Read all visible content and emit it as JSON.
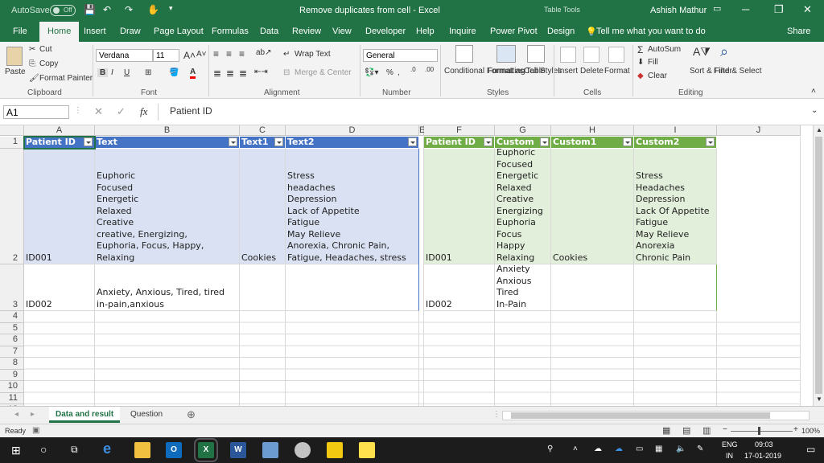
{
  "title_bar": {
    "autosave_label": "AutoSave",
    "autosave_state": "Off",
    "doc_title": "Remove duplicates from cell  -  Excel",
    "context_tab": "Table Tools",
    "user_name": "Ashish Mathur"
  },
  "menu": {
    "tabs": [
      "File",
      "Home",
      "Insert",
      "Draw",
      "Page Layout",
      "Formulas",
      "Data",
      "Review",
      "View",
      "Developer",
      "Help",
      "Inquire",
      "Power Pivot",
      "Design"
    ],
    "tell_me": "Tell me what you want to do",
    "share": "Share"
  },
  "ribbon": {
    "clipboard": {
      "paste": "Paste",
      "cut": "Cut",
      "copy": "Copy",
      "format_painter": "Format Painter",
      "group": "Clipboard"
    },
    "font": {
      "name": "Verdana",
      "size": "11",
      "group": "Font"
    },
    "alignment": {
      "wrap_text": "Wrap Text",
      "merge_center": "Merge & Center",
      "group": "Alignment"
    },
    "number": {
      "format": "General",
      "group": "Number"
    },
    "styles": {
      "conditional_formatting": "Conditional Formatting",
      "format_as_table": "Format as Table",
      "cell_styles": "Cell Styles",
      "group": "Styles"
    },
    "cells": {
      "insert": "Insert",
      "delete": "Delete",
      "format": "Format",
      "group": "Cells"
    },
    "editing": {
      "autosum": "AutoSum",
      "fill": "Fill",
      "clear": "Clear",
      "sort_filter": "Sort & Filter",
      "find_select": "Find & Select",
      "group": "Editing"
    }
  },
  "formula_bar": {
    "name_box": "A1",
    "fx": "fx",
    "content": "Patient ID"
  },
  "columns": [
    "A",
    "B",
    "C",
    "D",
    "E",
    "F",
    "G",
    "H",
    "I",
    "J"
  ],
  "rows": [
    "1",
    "2",
    "3",
    "4",
    "5",
    "6",
    "7",
    "8",
    "9",
    "10",
    "11",
    "12"
  ],
  "table1": {
    "headers": [
      "Patient ID",
      "Text",
      "Text1",
      "Text2"
    ],
    "rows": [
      [
        "ID001",
        "Euphoric\nFocused\nEnergetic\nRelaxed\nCreative\ncreative, Energizing,\nEuphoria, Focus, Happy,\nRelaxing",
        "Cookies",
        "Stress\nheadaches\nDepression\nLack of Appetite\nFatigue\nMay Relieve\nAnorexia, Chronic Pain,\nFatigue, Headaches, stress"
      ],
      [
        "ID002",
        "Anxiety, Anxious, Tired, tired\nin-pain,anxious",
        "",
        ""
      ]
    ]
  },
  "table2": {
    "headers": [
      "Patient ID",
      "Custom",
      "Custom1",
      "Custom2"
    ],
    "rows": [
      [
        "ID001",
        "Euphoric\nFocused\nEnergetic\nRelaxed\nCreative\nEnergizing\nEuphoria\nFocus\nHappy\nRelaxing",
        "Cookies",
        "Stress\nHeadaches\nDepression\nLack Of Appetite\nFatigue\nMay Relieve\nAnorexia\nChronic Pain"
      ],
      [
        "ID002",
        "Anxiety\nAnxious\nTired\nIn-Pain",
        "",
        ""
      ]
    ]
  },
  "sheets": {
    "tabs": [
      "Data and result",
      "Question"
    ],
    "active": "Data and result"
  },
  "status": {
    "ready": "Ready",
    "zoom": "100%"
  },
  "taskbar": {
    "lang": "ENG",
    "region": "IN",
    "time": "09:03",
    "date": "17-01-2019"
  },
  "colors": {
    "excel_green": "#217346",
    "table_blue": "#4472c4",
    "table_green": "#70ad47",
    "band_blue": "#d9e1f2",
    "band_green": "#e2efda"
  }
}
